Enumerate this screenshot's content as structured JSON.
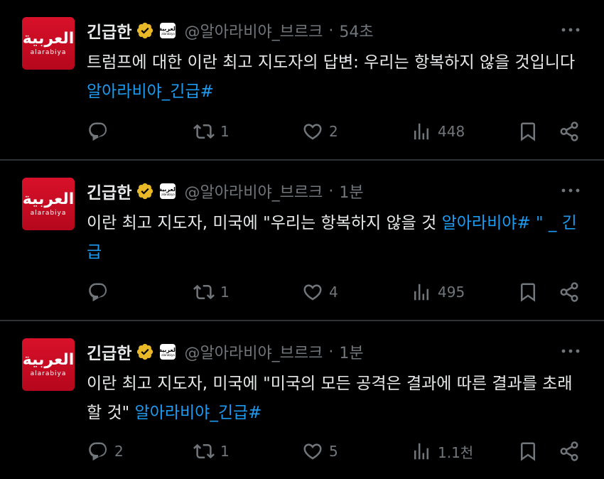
{
  "tweets": [
    {
      "avatar": {
        "arabic": "العربية",
        "latin": "alarabiya"
      },
      "name": "긴급한",
      "affiliate": {
        "top": "العربية",
        "bottom": "alarabiya"
      },
      "handle": "@알아라비야_브르크",
      "separator": "·",
      "time": "54초",
      "text": "트럼프에 대한 이란 최고 지도자의 답변: 우리는 항복하지 않을 것입니다 ",
      "link": "알아라비야_긴급#",
      "replies": "",
      "retweets": "1",
      "likes": "2",
      "views": "448"
    },
    {
      "avatar": {
        "arabic": "العربية",
        "latin": "alarabiya"
      },
      "name": "긴급한",
      "affiliate": {
        "top": "العربية",
        "bottom": "alarabiya"
      },
      "handle": "@알아라비야_브르크",
      "separator": "·",
      "time": "1분",
      "text": "이란 최고 지도자, 미국에 \"우리는 항복하지 않을 것 ",
      "link": "알아라비야# \" _ 긴급",
      "replies": "",
      "retweets": "1",
      "likes": "4",
      "views": "495"
    },
    {
      "avatar": {
        "arabic": "العربية",
        "latin": "alarabiya"
      },
      "name": "긴급한",
      "affiliate": {
        "top": "العربية",
        "bottom": "alarabiya"
      },
      "handle": "@알아라비야_브르크",
      "separator": "·",
      "time": "1분",
      "text": "이란 최고 지도자, 미국에 \"미국의 모든 공격은 결과에 따른 결과를 초래할 것\" ",
      "link": "알아라비야_긴급#",
      "replies": "2",
      "retweets": "1",
      "likes": "5",
      "views": "1.1천"
    }
  ],
  "colors": {
    "background": "#000000",
    "text": "#e7e9ea",
    "muted": "#71767b",
    "link": "#1d9bf0",
    "verified": "#e8b829",
    "avatar": "#d8112a"
  },
  "icons": [
    "reply-icon",
    "retweet-icon",
    "like-icon",
    "views-icon",
    "bookmark-icon",
    "share-icon",
    "more-icon",
    "verified-badge-icon"
  ]
}
